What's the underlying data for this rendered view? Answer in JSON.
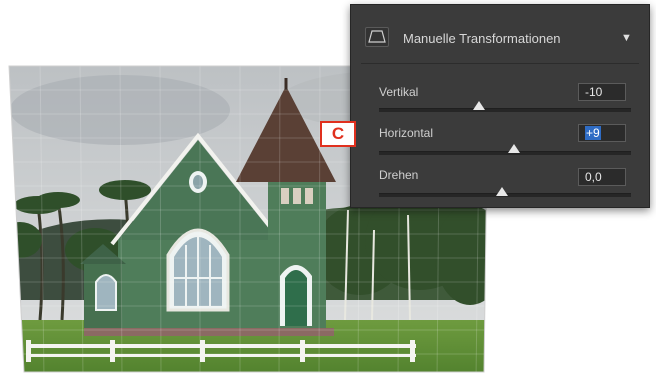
{
  "panel": {
    "title": "Manuelle Transformationen",
    "params": [
      {
        "label": "Vertikal",
        "value": "-10",
        "level": 0.45
      },
      {
        "label": "Horizontal",
        "value": "+9",
        "level": 0.55,
        "selected": true
      },
      {
        "label": "Drehen",
        "value": "0,0",
        "level": 0.5
      }
    ]
  },
  "callout": {
    "letter": "C",
    "color": "#e0301e"
  },
  "colors": {
    "panel_bg": "#3b3b3b",
    "selection": "#2f6cc4",
    "church_green": "#4f7d5a",
    "lawn": "#5e8f3a"
  },
  "icons": {
    "header": "perspective-transform-icon",
    "menu": "triangle-down-icon"
  }
}
